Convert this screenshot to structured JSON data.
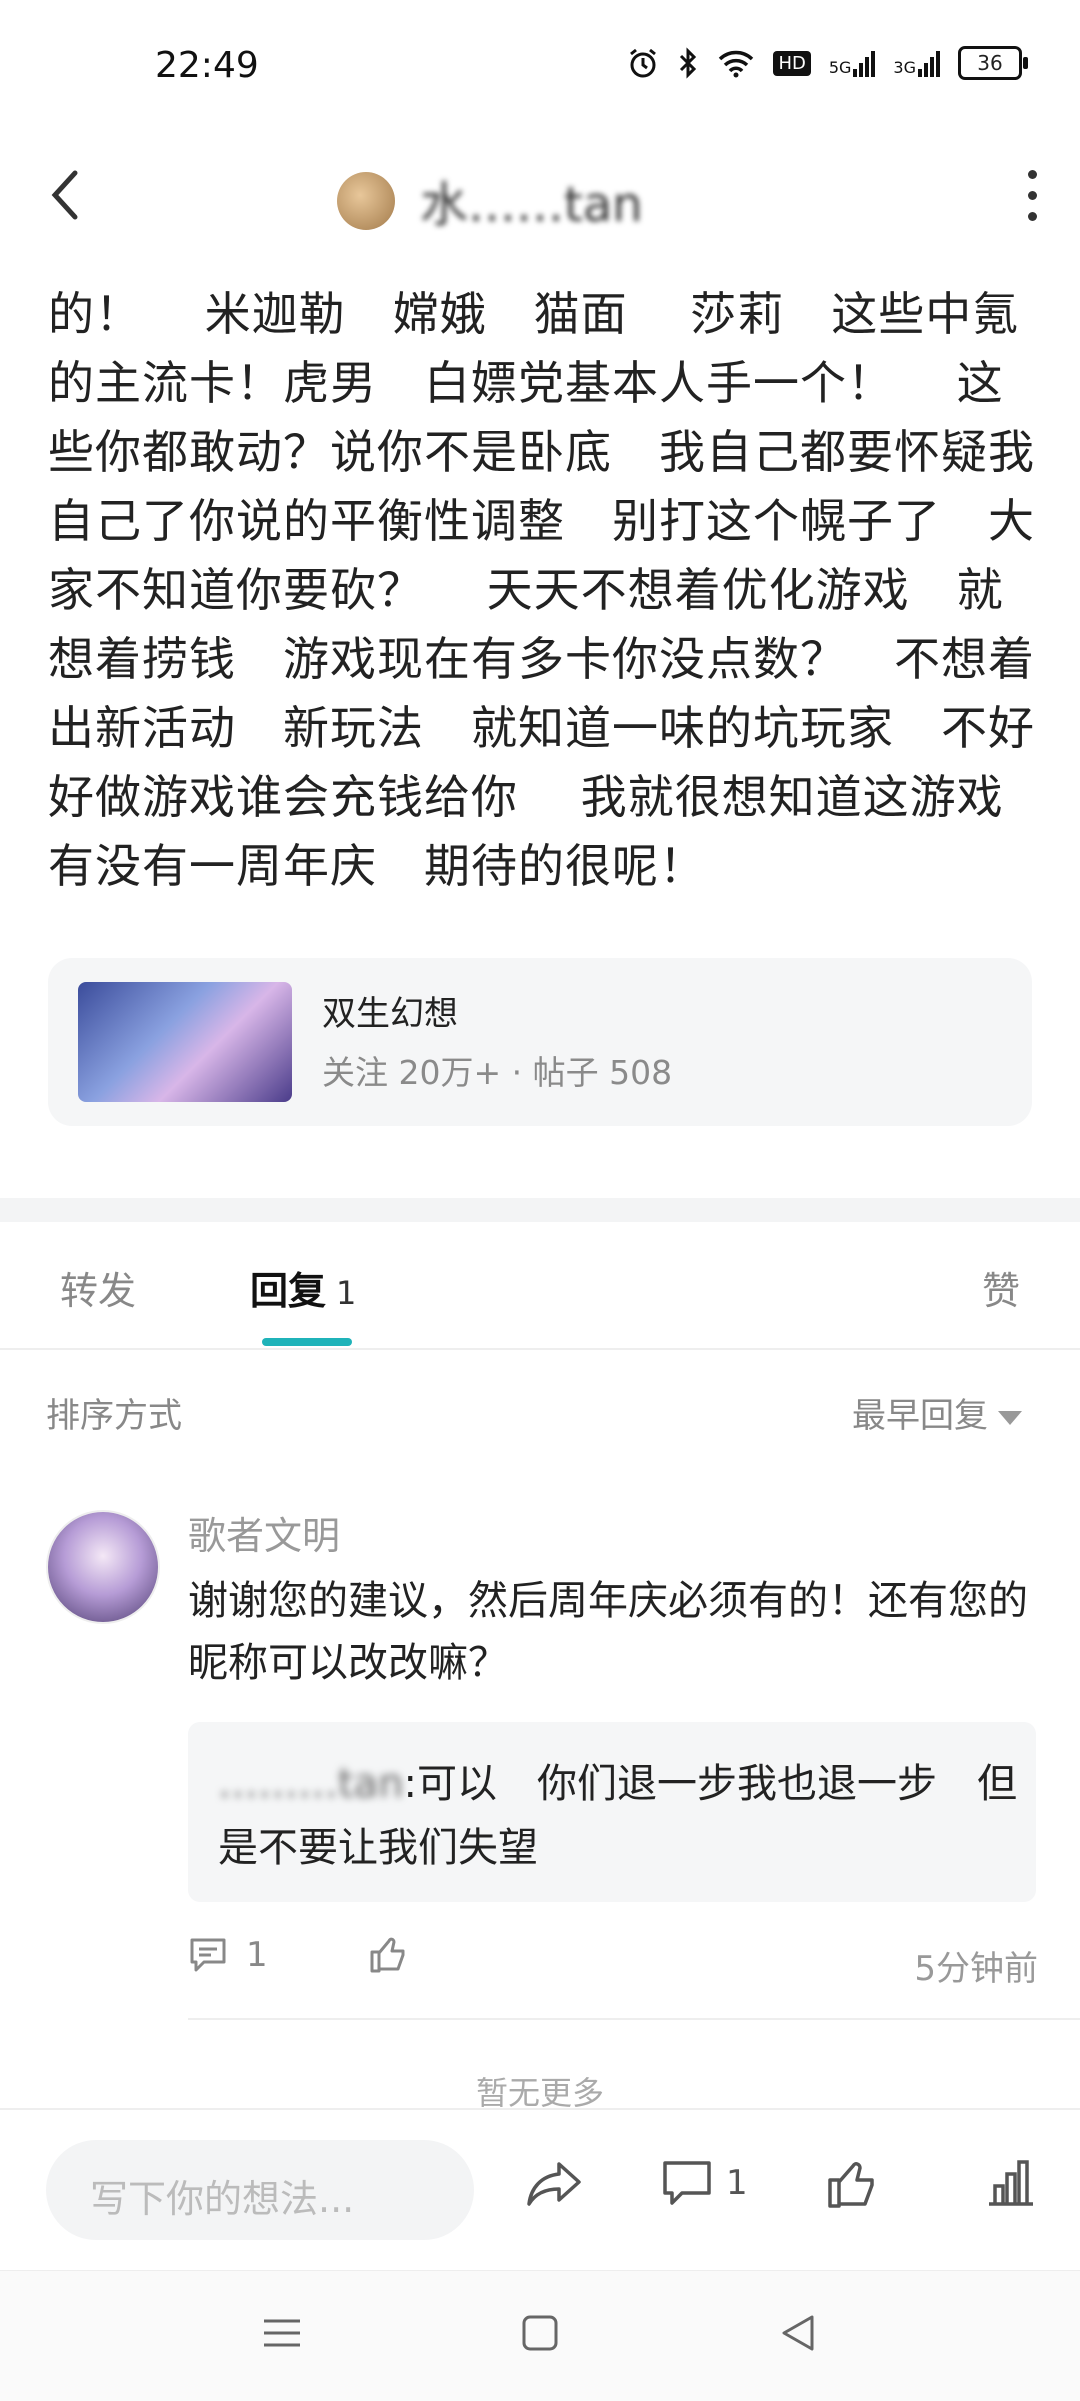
{
  "status_bar": {
    "time": "22:49",
    "network_1": "5G",
    "network_2": "3G",
    "hd_label": "HD",
    "battery": "36"
  },
  "header": {
    "username": "水……tan",
    "back_icon": "chevron-left-icon",
    "more_icon": "more-vertical-icon"
  },
  "post": {
    "text": "的！　 米迦勒　嫦娥　猫面　 莎莉　这些中氪的主流卡！虎男　白嫖党基本人手一个！　 这些你都敢动？说你不是卧底　我自己都要怀疑我自己了你说的平衡性调整　别打这个幌子了　大家不知道你要砍？　 天天不想着优化游戏　就想着捞钱　游戏现在有多卡你没点数？　不想着出新活动　新玩法　就知道一味的坑玩家　不好好做游戏谁会充钱给你　 我就很想知道这游戏有没有一周年庆　期待的很呢！"
  },
  "game_card": {
    "name": "双生幻想",
    "stats": "关注 20万+ · 帖子 508"
  },
  "tabs": {
    "forward": "转发",
    "reply": "回复",
    "reply_count": "1",
    "like": "赞"
  },
  "sort": {
    "label": "排序方式",
    "value": "最早回复"
  },
  "comment": {
    "author": "歌者文明",
    "text": "谢谢您的建议，然后周年庆必须有的！还有您的昵称可以改改嘛？",
    "quote_user": "………tan",
    "quote_text": ":可以　你们退一步我也退一步　但是不要让我们失望",
    "reply_count": "1",
    "time": "5分钟前"
  },
  "list_end": "暂无更多",
  "bottom_bar": {
    "input_placeholder": "写下你的想法...",
    "comment_count": "1"
  }
}
